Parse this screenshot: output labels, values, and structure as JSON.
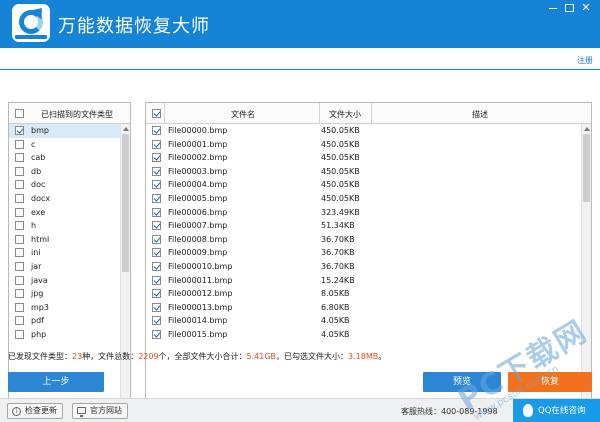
{
  "window": {
    "title": "万能数据恢复大师",
    "logo_icon": "recovery-logo-icon",
    "controls": {
      "minimize": "minimize-icon",
      "maximize": "maximize-icon",
      "close_label": "✕"
    }
  },
  "header": {
    "register_label": "注册"
  },
  "type_panel": {
    "title": "已扫描到的文件类型",
    "all_checked": false,
    "items": [
      {
        "label": "bmp",
        "checked": true,
        "selected": true
      },
      {
        "label": "c",
        "checked": false
      },
      {
        "label": "cab",
        "checked": false
      },
      {
        "label": "db",
        "checked": false
      },
      {
        "label": "doc",
        "checked": false
      },
      {
        "label": "docx",
        "checked": false
      },
      {
        "label": "exe",
        "checked": false
      },
      {
        "label": "h",
        "checked": false
      },
      {
        "label": "html",
        "checked": false
      },
      {
        "label": "ini",
        "checked": false
      },
      {
        "label": "jar",
        "checked": false
      },
      {
        "label": "java",
        "checked": false
      },
      {
        "label": "jpg",
        "checked": false
      },
      {
        "label": "mp3",
        "checked": false
      },
      {
        "label": "pdf",
        "checked": false
      },
      {
        "label": "php",
        "checked": false
      }
    ]
  },
  "file_panel": {
    "columns": {
      "name": "文件名",
      "size": "文件大小",
      "desc": "描述"
    },
    "all_checked": true,
    "rows": [
      {
        "name": "File00000.bmp",
        "size": "450.05KB",
        "checked": true
      },
      {
        "name": "File00001.bmp",
        "size": "450.05KB",
        "checked": true
      },
      {
        "name": "File00002.bmp",
        "size": "450.05KB",
        "checked": true
      },
      {
        "name": "File00003.bmp",
        "size": "450.05KB",
        "checked": true
      },
      {
        "name": "File00004.bmp",
        "size": "450.05KB",
        "checked": true
      },
      {
        "name": "File00005.bmp",
        "size": "450.05KB",
        "checked": true
      },
      {
        "name": "File00006.bmp",
        "size": "323.49KB",
        "checked": true
      },
      {
        "name": "File00007.bmp",
        "size": "51.34KB",
        "checked": true
      },
      {
        "name": "File00008.bmp",
        "size": "36.70KB",
        "checked": true
      },
      {
        "name": "File00009.bmp",
        "size": "36.70KB",
        "checked": true
      },
      {
        "name": "File000010.bmp",
        "size": "36.70KB",
        "checked": true
      },
      {
        "name": "File000011.bmp",
        "size": "15.24KB",
        "checked": true
      },
      {
        "name": "File000012.bmp",
        "size": "8.05KB",
        "checked": true
      },
      {
        "name": "File000013.bmp",
        "size": "6.80KB",
        "checked": true
      },
      {
        "name": "File00014.bmp",
        "size": "4.05KB",
        "checked": true
      },
      {
        "name": "File00015.bmp",
        "size": "4.05KB",
        "checked": true
      }
    ]
  },
  "status": {
    "prefix": "已发现文件类型：",
    "type_count": "23",
    "type_unit": "种，文件总数：",
    "file_count": "2209",
    "file_unit": "个，全部文件大小合计：",
    "total_size": "5.41GB",
    "selected_prefix": "，已勾选文件大小：",
    "selected_size": "3.18MB",
    "suffix": "。"
  },
  "actions": {
    "prev_label": "上一步",
    "preview_label": "预览",
    "recover_label": "恢复"
  },
  "footer": {
    "update_label": "检查更新",
    "site_label": "官方网站",
    "hotline": "客服热线：400-089-1998",
    "qq_label": "QQ在线咨询"
  },
  "watermark": {
    "main": "PC下载网",
    "sub": "www.pcsoft.com.cn"
  },
  "colors": {
    "brand_blue": "#1684d6",
    "accent_orange": "#f1711c",
    "highlight_red": "#e8491d"
  }
}
